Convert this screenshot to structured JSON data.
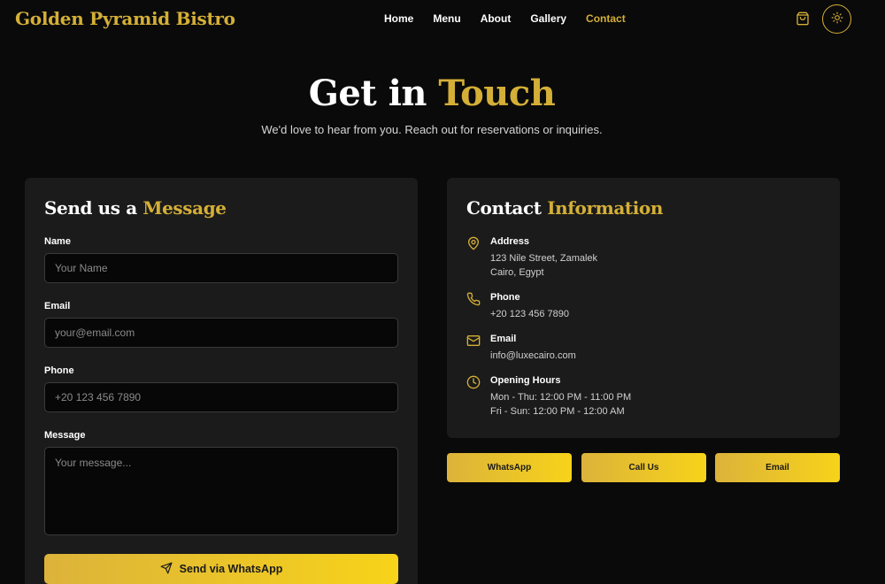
{
  "brand": "Golden Pyramid Bistro",
  "nav": [
    {
      "label": "Home"
    },
    {
      "label": "Menu"
    },
    {
      "label": "About"
    },
    {
      "label": "Gallery"
    },
    {
      "label": "Contact"
    }
  ],
  "active_nav": "Contact",
  "icons": {
    "cart": "shopping-bag-icon",
    "theme": "sun-icon"
  },
  "colors": {
    "accent": "#d4af37",
    "background": "#0a0a0a",
    "card": "#1b1b1b"
  },
  "hero": {
    "title_main": "Get in",
    "title_accent": "Touch",
    "subtitle": "We'd love to hear from you. Reach out for reservations or inquiries."
  },
  "form": {
    "title_main": "Send us a",
    "title_accent": "Message",
    "name_label": "Name",
    "name_placeholder": "Your Name",
    "email_label": "Email",
    "email_placeholder": "your@email.com",
    "phone_label": "Phone",
    "phone_placeholder": "+20 123 456 7890",
    "message_label": "Message",
    "message_placeholder": "Your message...",
    "submit_label": "Send via WhatsApp"
  },
  "contact": {
    "title_main": "Contact",
    "title_accent": "Information",
    "address_label": "Address",
    "address_line1": "123 Nile Street, Zamalek",
    "address_line2": "Cairo, Egypt",
    "phone_label": "Phone",
    "phone_value": "+20 123 456 7890",
    "email_label": "Email",
    "email_value": "info@luxecairo.com",
    "hours_label": "Opening Hours",
    "hours_line1": "Mon - Thu: 12:00 PM - 11:00 PM",
    "hours_line2": "Fri - Sun: 12:00 PM - 12:00 AM"
  },
  "actions": {
    "whatsapp": "WhatsApp",
    "call": "Call Us",
    "email": "Email"
  }
}
